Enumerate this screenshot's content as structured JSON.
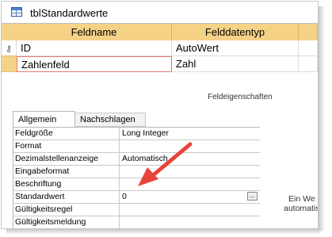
{
  "window": {
    "title": "tblStandardwerte"
  },
  "design_grid": {
    "headers": {
      "fieldname": "Feldname",
      "datatype": "Felddatentyp"
    },
    "rows": [
      {
        "name": "ID",
        "type": "AutoWert",
        "primary_key": true
      },
      {
        "name": "Zahlenfeld",
        "type": "Zahl",
        "selected": true
      }
    ]
  },
  "properties": {
    "caption": "Feldeigenschaften",
    "tabs": [
      "Allgemein",
      "Nachschlagen"
    ],
    "active_tab": "Allgemein",
    "rows": [
      {
        "label": "Feldgröße",
        "value": "Long Integer"
      },
      {
        "label": "Format",
        "value": ""
      },
      {
        "label": "Dezimalstellenanzeige",
        "value": "Automatisch"
      },
      {
        "label": "Eingabeformat",
        "value": ""
      },
      {
        "label": "Beschriftung",
        "value": ""
      },
      {
        "label": "Standardwert",
        "value": "0"
      },
      {
        "label": "Gültigkeitsregel",
        "value": ""
      },
      {
        "label": "Gültigkeitsmeldung",
        "value": ""
      }
    ],
    "build_button": "..."
  },
  "hint": {
    "line1": "Ein We",
    "line2": "automatis"
  },
  "colors": {
    "header": "#f6d287",
    "selection_border": "#e07a7a",
    "arrow": "#e8443a"
  },
  "icons": {
    "table": "table-icon",
    "key": "key-icon",
    "arrow": "red-arrow-icon"
  }
}
